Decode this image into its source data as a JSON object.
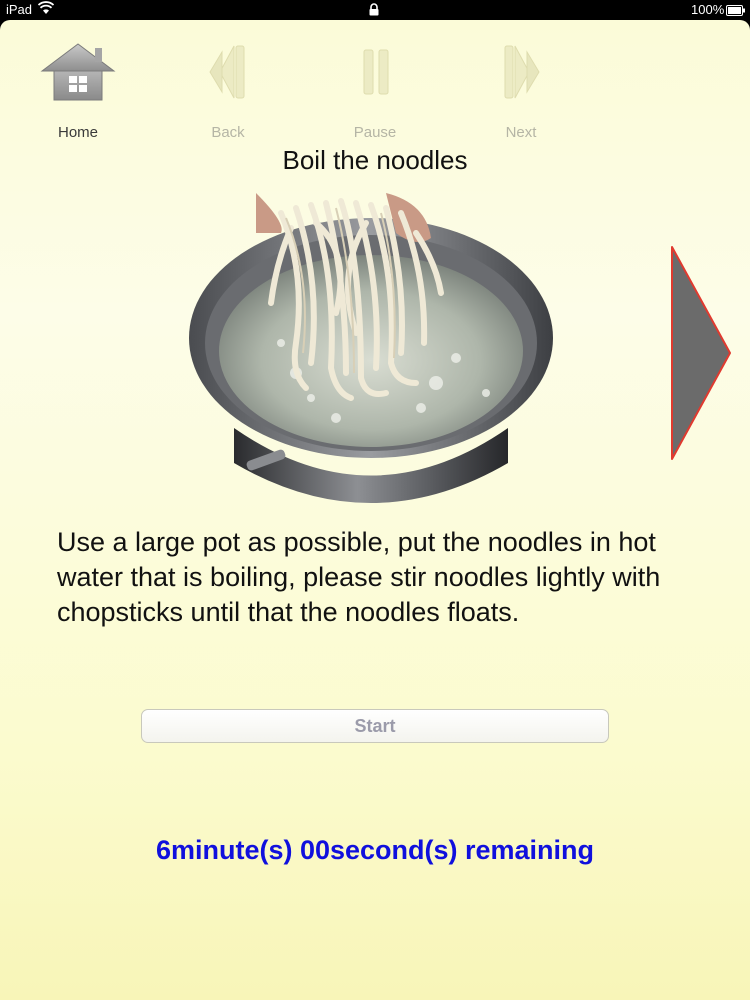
{
  "status_bar": {
    "device": "iPad",
    "battery_text": "100%",
    "icons": [
      "wifi-icon",
      "lock-icon",
      "battery-icon"
    ]
  },
  "toolbar": {
    "home_label": "Home",
    "back_label": "Back",
    "pause_label": "Pause",
    "next_label": "Next",
    "icons": [
      "home-icon",
      "back-icon",
      "pause-icon",
      "next-icon"
    ]
  },
  "step": {
    "title": "Boil the noodles",
    "instructions": "Use a large pot as possible,  put the noodles in hot water that is boiling, please stir noodles lightly with chopsticks until that the noodles floats."
  },
  "timer": {
    "start_label": "Start",
    "remaining_text": "6minute(s) 00second(s) remaining"
  },
  "colors": {
    "background": "#fdfde8",
    "timer_text": "#1010dd",
    "next_arrow_fill": "#6b6b6b",
    "next_arrow_outline": "#e03a2f",
    "disabled_label": "#b5b5a5"
  }
}
